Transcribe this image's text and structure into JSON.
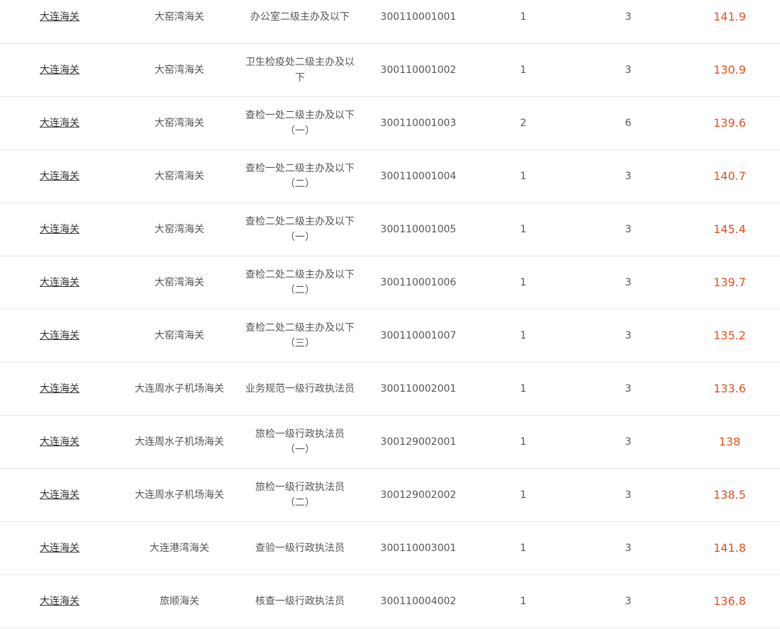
{
  "colors": {
    "score": "#e8501e",
    "text": "#555555",
    "link": "#333333",
    "divider": "#e8e8e8"
  },
  "rows": [
    {
      "customs": "大连海关",
      "unit": "大窑湾海关",
      "position": "办公室二级主办及以下",
      "code": "300110001001",
      "plan": "1",
      "ratio": "3",
      "score": "141.9"
    },
    {
      "customs": "大连海关",
      "unit": "大窑湾海关",
      "position": "卫生检疫处二级主办及以\n下",
      "code": "300110001002",
      "plan": "1",
      "ratio": "3",
      "score": "130.9"
    },
    {
      "customs": "大连海关",
      "unit": "大窑湾海关",
      "position": "查检一处二级主办及以下\n（一）",
      "code": "300110001003",
      "plan": "2",
      "ratio": "6",
      "score": "139.6"
    },
    {
      "customs": "大连海关",
      "unit": "大窑湾海关",
      "position": "查检一处二级主办及以下\n（二）",
      "code": "300110001004",
      "plan": "1",
      "ratio": "3",
      "score": "140.7"
    },
    {
      "customs": "大连海关",
      "unit": "大窑湾海关",
      "position": "查检二处二级主办及以下\n（一）",
      "code": "300110001005",
      "plan": "1",
      "ratio": "3",
      "score": "145.4"
    },
    {
      "customs": "大连海关",
      "unit": "大窑湾海关",
      "position": "查检二处二级主办及以下\n（二）",
      "code": "300110001006",
      "plan": "1",
      "ratio": "3",
      "score": "139.7"
    },
    {
      "customs": "大连海关",
      "unit": "大窑湾海关",
      "position": "查检二处二级主办及以下\n（三）",
      "code": "300110001007",
      "plan": "1",
      "ratio": "3",
      "score": "135.2"
    },
    {
      "customs": "大连海关",
      "unit": "大连周水子机场海关",
      "position": "业务规范一级行政执法员",
      "code": "300110002001",
      "plan": "1",
      "ratio": "3",
      "score": "133.6"
    },
    {
      "customs": "大连海关",
      "unit": "大连周水子机场海关",
      "position": "旅检一级行政执法员\n（一）",
      "code": "300129002001",
      "plan": "1",
      "ratio": "3",
      "score": "138"
    },
    {
      "customs": "大连海关",
      "unit": "大连周水子机场海关",
      "position": "旅检一级行政执法员\n（二）",
      "code": "300129002002",
      "plan": "1",
      "ratio": "3",
      "score": "138.5"
    },
    {
      "customs": "大连海关",
      "unit": "大连港湾海关",
      "position": "查验一级行政执法员",
      "code": "300110003001",
      "plan": "1",
      "ratio": "3",
      "score": "141.8"
    },
    {
      "customs": "大连海关",
      "unit": "旅顺海关",
      "position": "核查一级行政执法员",
      "code": "300110004002",
      "plan": "1",
      "ratio": "3",
      "score": "136.8"
    }
  ]
}
